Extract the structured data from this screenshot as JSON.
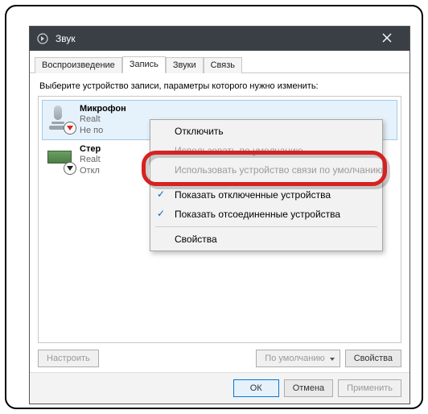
{
  "window": {
    "title": "Звук"
  },
  "tabs": {
    "playback": "Воспроизведение",
    "recording": "Запись",
    "sounds": "Звуки",
    "communications": "Связь"
  },
  "body": {
    "prompt": "Выберите устройство записи, параметры которого нужно изменить:"
  },
  "devices": [
    {
      "name": "Микрофон",
      "line1": "Realt",
      "line2": "Не по"
    },
    {
      "name": "Стер",
      "line1": "Realt",
      "line2": "Откл"
    }
  ],
  "bottom": {
    "configure": "Настроить",
    "default": "По умолчанию",
    "properties": "Свойства"
  },
  "footer": {
    "ok": "ОК",
    "cancel": "Отмена",
    "apply": "Применить"
  },
  "context_menu": {
    "items": {
      "disable": "Отключить",
      "set_default": "Использовать по умолчанию",
      "set_default_comm": "Использовать устройство связи по умолчанию",
      "show_disabled": "Показать отключенные устройства",
      "show_disconnected": "Показать отсоединенные устройства",
      "properties": "Свойства"
    }
  }
}
